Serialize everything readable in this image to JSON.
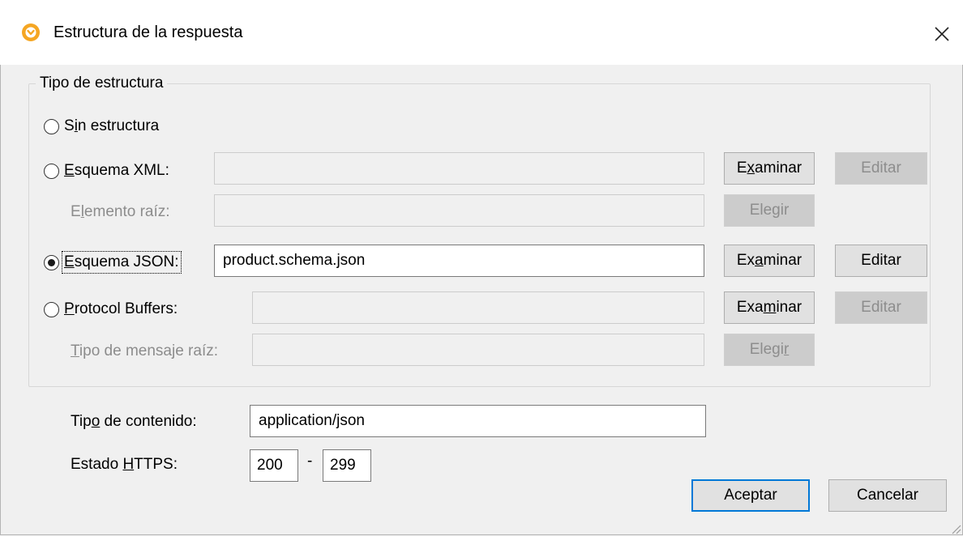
{
  "window": {
    "title": "Estructura de la respuesta"
  },
  "group": {
    "legend": "Tipo de estructura"
  },
  "options": {
    "none": {
      "pre": "S",
      "key": "i",
      "post": "n estructura",
      "selected": false
    },
    "xml": {
      "pre": "",
      "key": "E",
      "post": "squema XML:",
      "selected": false,
      "value": "",
      "browse": {
        "pre": "E",
        "key": "x",
        "post": "aminar"
      },
      "edit": "Editar",
      "root_label": {
        "pre": "E",
        "key": "l",
        "post": "emento raíz:"
      },
      "root_value": "",
      "choose": {
        "pre": "Ele",
        "key": "g",
        "post": "ir"
      }
    },
    "json": {
      "pre": "",
      "key": "E",
      "post": "squema JSON:",
      "selected": true,
      "value": "product.schema.json",
      "browse": {
        "pre": "Ex",
        "key": "a",
        "post": "minar"
      },
      "edit": "Editar"
    },
    "protobuf": {
      "pre": "",
      "key": "P",
      "post": "rotocol Buffers:",
      "selected": false,
      "value": "",
      "browse": {
        "pre": "Exa",
        "key": "m",
        "post": "inar"
      },
      "edit": "Editar",
      "root_label": {
        "pre": "",
        "key": "T",
        "post": "ipo de mensaje raíz:"
      },
      "root_value": "",
      "choose": {
        "pre": "Elegi",
        "key": "r",
        "post": ""
      }
    }
  },
  "content_type": {
    "label_pre": "Tip",
    "label_key": "o",
    "label_post": " de contenido:",
    "value": "application/json"
  },
  "https_status": {
    "label_pre": "Estado ",
    "label_key": "H",
    "label_post": "TTPS:",
    "from": "200",
    "separator": "-",
    "to": "299"
  },
  "footer": {
    "ok": "Aceptar",
    "cancel": "Cancelar"
  },
  "colors": {
    "accent": "#0078d7",
    "icon": "#f5a623"
  }
}
